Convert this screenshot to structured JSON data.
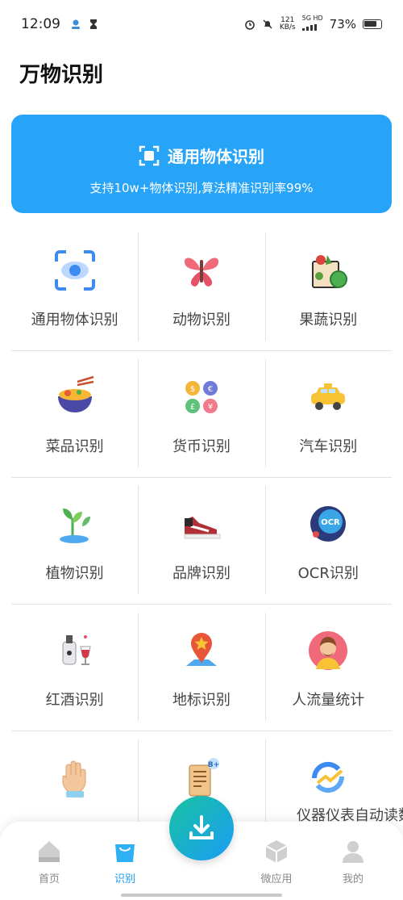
{
  "status": {
    "time": "12:09",
    "speed": "121",
    "speed_unit": "KB/s",
    "net_type": "5G HD",
    "battery": "73%"
  },
  "page_title": "万物识别",
  "banner": {
    "title": "通用物体识别",
    "subtitle": "支持10w+物体识别,算法精准识别率99%",
    "color": "#27a4f8"
  },
  "grid": {
    "rows": [
      [
        {
          "label": "通用物体识别",
          "icon": "eye-scan-icon"
        },
        {
          "label": "动物识别",
          "icon": "butterfly-icon"
        },
        {
          "label": "果蔬识别",
          "icon": "vegetable-basket-icon"
        }
      ],
      [
        {
          "label": "菜品识别",
          "icon": "noodle-bowl-icon"
        },
        {
          "label": "货币识别",
          "icon": "coins-icon"
        },
        {
          "label": "汽车识别",
          "icon": "taxi-icon"
        }
      ],
      [
        {
          "label": "植物识别",
          "icon": "plant-icon"
        },
        {
          "label": "品牌识别",
          "icon": "sneaker-icon"
        },
        {
          "label": "OCR识别",
          "icon": "ocr-icon"
        }
      ],
      [
        {
          "label": "红酒识别",
          "icon": "wine-icon"
        },
        {
          "label": "地标识别",
          "icon": "landmark-pin-icon"
        },
        {
          "label": "人流量统计",
          "icon": "person-avatar-icon"
        }
      ],
      [
        {
          "label": "",
          "icon": "hand-icon"
        },
        {
          "label": "",
          "icon": "scroll-icon"
        },
        {
          "label": "",
          "icon": "refresh-chart-icon"
        }
      ]
    ],
    "partial_label": "仪器仪表自动读数"
  },
  "bottom_nav": {
    "items": [
      {
        "label": "首页",
        "icon": "home-icon"
      },
      {
        "label": "识别",
        "icon": "shopping-bag-icon"
      },
      {
        "label": "微应用",
        "icon": "cube-icon"
      },
      {
        "label": "我的",
        "icon": "user-icon"
      }
    ],
    "active_color": "#1a9cf5"
  }
}
